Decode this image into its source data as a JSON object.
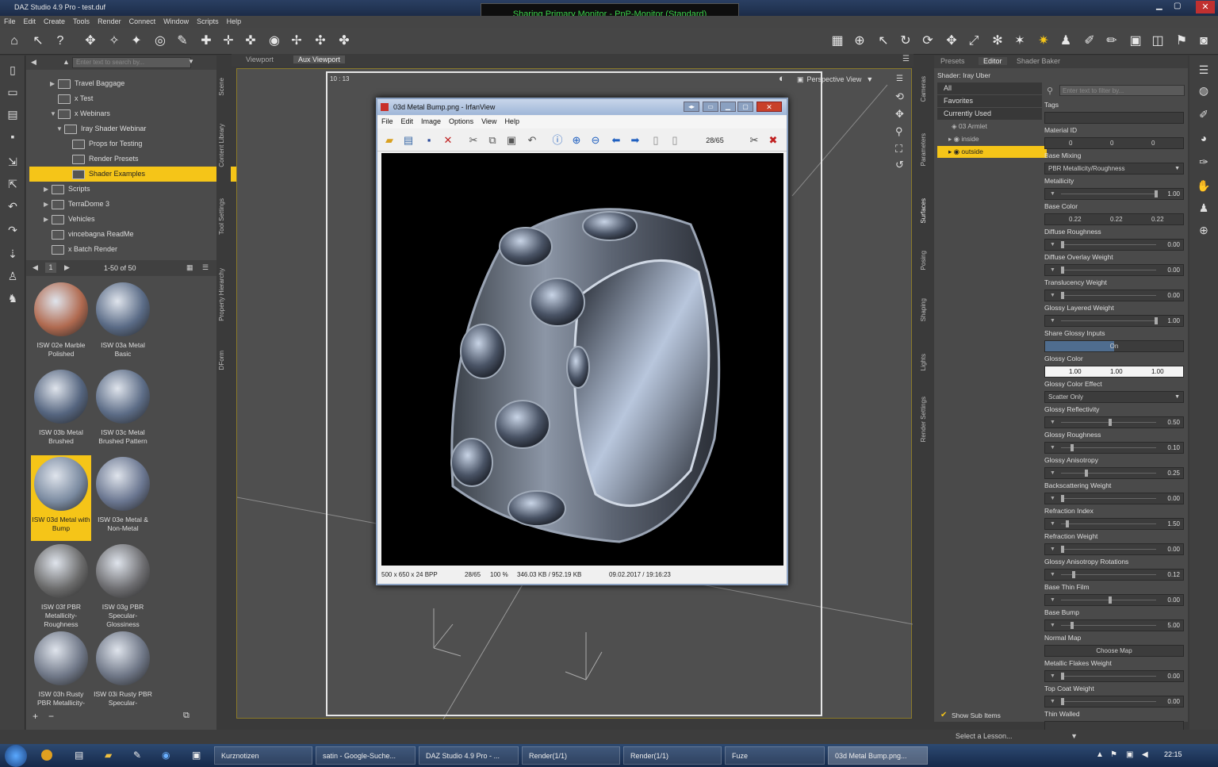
{
  "window": {
    "title": "DAZ Studio 4.9 Pro - test.duf"
  },
  "banner": {
    "text": "Sharing Primary Monitor - PnP-Monitor (Standard)"
  },
  "menus": [
    "File",
    "Edit",
    "Create",
    "Tools",
    "Render",
    "Connect",
    "Window",
    "Scripts",
    "Help"
  ],
  "library": {
    "search_placeholder": "Enter text to search by...",
    "tree": [
      {
        "label": "Travel Baggage",
        "level": 2,
        "arrow": "▶"
      },
      {
        "label": "x Test",
        "level": 2,
        "arrow": ""
      },
      {
        "label": "x Webinars",
        "level": 2,
        "arrow": "▼"
      },
      {
        "label": "Iray Shader Webinar",
        "level": 3,
        "arrow": "▼"
      },
      {
        "label": "Props for Testing",
        "level": 4,
        "arrow": ""
      },
      {
        "label": "Render Presets",
        "level": 4,
        "arrow": ""
      },
      {
        "label": "Shader Examples",
        "level": 4,
        "arrow": "",
        "selected": true
      },
      {
        "label": "Scripts",
        "level": 1,
        "arrow": "▶"
      },
      {
        "label": "TerraDome 3",
        "level": 1,
        "arrow": "▶"
      },
      {
        "label": "Vehicles",
        "level": 1,
        "arrow": "▶"
      },
      {
        "label": "vincebagna ReadMe",
        "level": 1,
        "arrow": ""
      },
      {
        "label": "x Batch Render",
        "level": 1,
        "arrow": ""
      }
    ],
    "page_number": "1",
    "range": "1-50 of 50",
    "thumbs": [
      {
        "label": "ISW 02e Marble Polished",
        "color": "#b06a50"
      },
      {
        "label": "ISW 03a Metal Basic",
        "color": "#5a6b86"
      },
      {
        "label": "ISW 03b Metal Brushed",
        "color": "#55657f"
      },
      {
        "label": "ISW 03c Metal Brushed Pattern",
        "color": "#5c6c86"
      },
      {
        "label": "ISW 03d Metal with Bump",
        "color": "#7a8aa0",
        "selected": true
      },
      {
        "label": "ISW 03e Metal & Non-Metal",
        "color": "#6a7690"
      },
      {
        "label": "ISW 03f PBR Metallicity-Roughness",
        "color": "#6b6b6b"
      },
      {
        "label": "ISW 03g PBR Specular-Glossiness",
        "color": "#6d6d70"
      },
      {
        "label": "ISW 03h Rusty PBR Metallicity-",
        "color": "#707888"
      },
      {
        "label": "ISW 03i Rusty PBR Specular-",
        "color": "#6e7686"
      }
    ]
  },
  "side_tabs": [
    "Scene",
    "Content Library",
    "Tool Settings",
    "Property Hierarchy",
    "DForm"
  ],
  "viewport": {
    "tabs": [
      "Viewport",
      "Aux Viewport"
    ],
    "camera": "Perspective View",
    "timecode": "10 : 13"
  },
  "irfan": {
    "title": "03d Metal Bump.png - IrfanView",
    "menu": [
      "File",
      "Edit",
      "Image",
      "Options",
      "View",
      "Help"
    ],
    "page": "28/65",
    "status": {
      "dims": "500 x 650 x 24 BPP",
      "page": "28/65",
      "zoom": "100 %",
      "size": "346.03 KB / 952.19 KB",
      "date": "09.02.2017 / 19:16:23"
    }
  },
  "right_tabs": [
    "Cameras",
    "Parameters",
    "Surfaces",
    "Posing",
    "Shaping",
    "Lights",
    "Render Settings"
  ],
  "surfaces": {
    "tabs": [
      "Presets",
      "Editor",
      "Shader Baker"
    ],
    "shader": "Shader: Iray Uber",
    "filters": [
      "All",
      "Favorites",
      "Currently Used"
    ],
    "root": "03 Armlet",
    "materials": [
      {
        "label": "inside"
      },
      {
        "label": "outside",
        "selected": true
      }
    ],
    "search_placeholder": "Enter text to filter by...",
    "props": [
      {
        "name": "Tags",
        "value": ""
      },
      {
        "name": "Material ID",
        "values": [
          "0",
          "0",
          "0"
        ]
      },
      {
        "name": "Base Mixing",
        "value": "PBR Metallicity/Roughness",
        "kind": "dropdown"
      },
      {
        "name": "Metallicity",
        "value": "1.00",
        "pos": 0.98
      },
      {
        "name": "Base Color",
        "values": [
          "0.22",
          "0.22",
          "0.22"
        ],
        "kind": "color"
      },
      {
        "name": "Diffuse Roughness",
        "value": "0.00",
        "pos": 0
      },
      {
        "name": "Diffuse Overlay Weight",
        "value": "0.00",
        "pos": 0
      },
      {
        "name": "Translucency Weight",
        "value": "0.00",
        "pos": 0
      },
      {
        "name": "Glossy Layered Weight",
        "value": "1.00",
        "pos": 0.98
      },
      {
        "name": "Share Glossy Inputs",
        "value": "On",
        "kind": "toggle"
      },
      {
        "name": "Glossy Color",
        "values": [
          "1.00",
          "1.00",
          "1.00"
        ],
        "kind": "white"
      },
      {
        "name": "Glossy Color Effect",
        "value": "Scatter Only",
        "kind": "dropdown"
      },
      {
        "name": "Glossy Reflectivity",
        "value": "0.50",
        "pos": 0.5
      },
      {
        "name": "Glossy Roughness",
        "value": "0.10",
        "pos": 0.1
      },
      {
        "name": "Glossy Anisotropy",
        "value": "0.25",
        "pos": 0.25
      },
      {
        "name": "Backscattering Weight",
        "value": "0.00",
        "pos": 0
      },
      {
        "name": "Refraction Index",
        "value": "1.50",
        "pos": 0.05
      },
      {
        "name": "Refraction Weight",
        "value": "0.00",
        "pos": 0
      },
      {
        "name": "Glossy Anisotropy Rotations",
        "value": "0.12",
        "pos": 0.12
      },
      {
        "name": "Base Thin Film",
        "value": "0.00",
        "pos": 0.5
      },
      {
        "name": "Base Bump",
        "value": "5.00",
        "pos": 0.1
      },
      {
        "name": "Normal Map",
        "value": "Choose Map",
        "kind": "choose"
      },
      {
        "name": "Metallic Flakes Weight",
        "value": "0.00",
        "pos": 0
      },
      {
        "name": "Top Coat Weight",
        "value": "0.00",
        "pos": 0
      },
      {
        "name": "Thin Walled",
        "value": ""
      }
    ],
    "show_sub_items": "Show Sub Items"
  },
  "lesson": "Select a Lesson...",
  "taskbar": {
    "items": [
      {
        "label": "Kurznotizen"
      },
      {
        "label": "satin - Google-Suche..."
      },
      {
        "label": "DAZ Studio 4.9 Pro - ..."
      },
      {
        "label": "Render(1/1)"
      },
      {
        "label": "Render(1/1)"
      },
      {
        "label": "Fuze"
      },
      {
        "label": "03d Metal Bump.png...",
        "active": true
      }
    ],
    "clock": "22:15"
  }
}
